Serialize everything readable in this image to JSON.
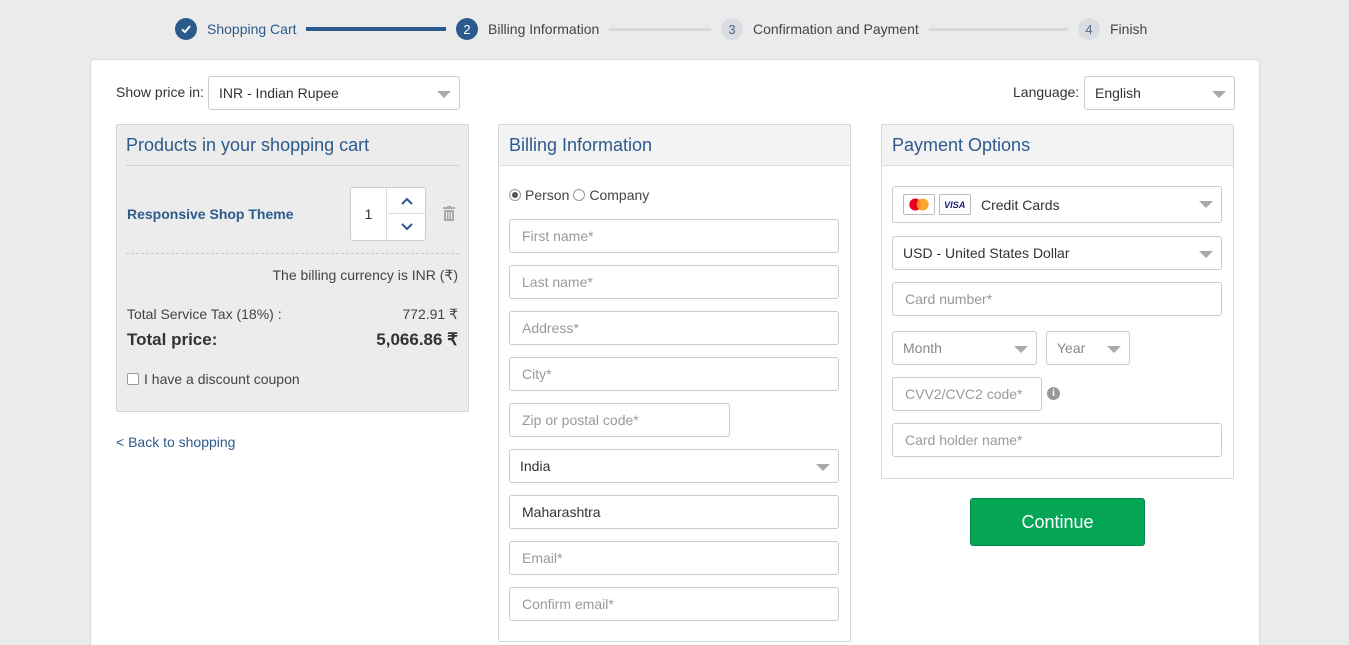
{
  "stepper": {
    "steps": [
      {
        "number": "1",
        "label": "Shopping Cart"
      },
      {
        "number": "2",
        "label": "Billing Information"
      },
      {
        "number": "3",
        "label": "Confirmation and Payment"
      },
      {
        "number": "4",
        "label": "Finish"
      }
    ]
  },
  "topbar": {
    "price_label": "Show price in:",
    "price_currency": "INR - Indian Rupee",
    "language_label": "Language:",
    "language_value": "English"
  },
  "cart": {
    "title": "Products in your shopping cart",
    "product_name": "Responsive Shop Theme",
    "quantity": "1",
    "billing_currency_note": "The billing currency is INR (₹)",
    "tax_label": "Total Service Tax (18%) :",
    "tax_value": "772.91 ₹",
    "total_label": "Total price:",
    "total_value": "5,066.86 ₹",
    "coupon_label": "I have a discount coupon",
    "back_link": "< Back to shopping"
  },
  "billing": {
    "title": "Billing Information",
    "type_options": [
      "Person",
      "Company"
    ],
    "selected_type": "Person",
    "first_name_placeholder": "First name*",
    "last_name_placeholder": "Last name*",
    "address_placeholder": "Address*",
    "city_placeholder": "City*",
    "zip_placeholder": "Zip or postal code*",
    "country": "India",
    "state": "Maharashtra",
    "email_placeholder": "Email*",
    "confirm_email_placeholder": "Confirm email*"
  },
  "payment": {
    "title": "Payment Options",
    "method": "Credit Cards",
    "card_logos": [
      "mastercard-icon",
      "visa-icon"
    ],
    "currency": "USD - United States Dollar",
    "card_number_placeholder": "Card number*",
    "month_placeholder": "Month",
    "year_placeholder": "Year",
    "cvv_placeholder": "CVV2/CVC2 code*",
    "holder_placeholder": "Card holder name*",
    "continue_label": "Continue"
  },
  "colors": {
    "brand": "#2d5a8c",
    "continue": "#04a555"
  }
}
